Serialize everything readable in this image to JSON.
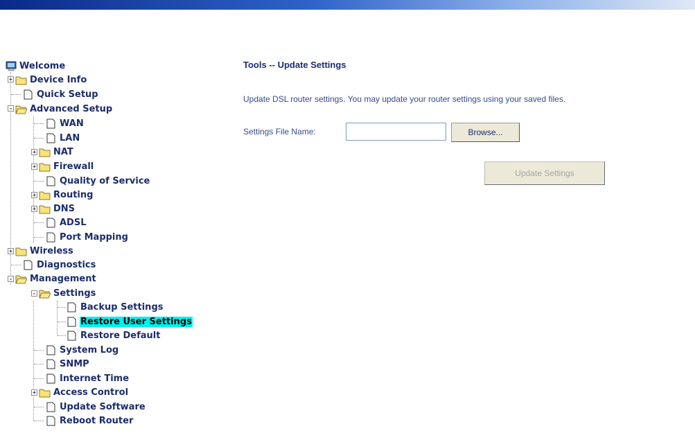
{
  "colors": {
    "header_gradient_start": "#0a2a8a",
    "header_gradient_end": "#dfe8f6",
    "tree_text": "#1c2c6c",
    "selected_highlight": "#00f0f0",
    "body_text": "#344a8a"
  },
  "sidebar": {
    "root": {
      "label": "Welcome",
      "icon": "computer-icon"
    },
    "items": [
      {
        "label": "Device Info",
        "icon": "folder-icon",
        "expander": "+"
      },
      {
        "label": "Quick Setup",
        "icon": "page-icon"
      },
      {
        "label": "Advanced Setup",
        "icon": "folder-open-icon",
        "expander": "-"
      },
      {
        "label": "WAN",
        "icon": "page-icon"
      },
      {
        "label": "LAN",
        "icon": "page-icon"
      },
      {
        "label": "NAT",
        "icon": "folder-icon",
        "expander": "+"
      },
      {
        "label": "Firewall",
        "icon": "folder-icon",
        "expander": "+"
      },
      {
        "label": "Quality of Service",
        "icon": "page-icon"
      },
      {
        "label": "Routing",
        "icon": "folder-icon",
        "expander": "+"
      },
      {
        "label": "DNS",
        "icon": "folder-icon",
        "expander": "+"
      },
      {
        "label": "ADSL",
        "icon": "page-icon"
      },
      {
        "label": "Port Mapping",
        "icon": "page-icon"
      },
      {
        "label": "Wireless",
        "icon": "folder-icon",
        "expander": "+"
      },
      {
        "label": "Diagnostics",
        "icon": "page-icon"
      },
      {
        "label": "Management",
        "icon": "folder-open-icon",
        "expander": "-"
      },
      {
        "label": "Settings",
        "icon": "folder-open-icon",
        "expander": "-"
      },
      {
        "label": "Backup Settings",
        "icon": "page-icon"
      },
      {
        "label": "Restore User Settings",
        "icon": "page-icon",
        "selected": true
      },
      {
        "label": "Restore Default",
        "icon": "page-icon"
      },
      {
        "label": "System Log",
        "icon": "page-icon"
      },
      {
        "label": "SNMP",
        "icon": "page-icon"
      },
      {
        "label": "Internet Time",
        "icon": "page-icon"
      },
      {
        "label": "Access Control",
        "icon": "folder-icon",
        "expander": "+"
      },
      {
        "label": "Update Software",
        "icon": "page-icon"
      },
      {
        "label": "Reboot Router",
        "icon": "page-icon"
      }
    ]
  },
  "main": {
    "title": "Tools -- Update Settings",
    "description": "Update DSL router settings. You may update your router settings using your saved files.",
    "file_label": "Settings File Name:",
    "file_value": "",
    "browse_label": "Browse...",
    "update_label": "Update Settings"
  }
}
